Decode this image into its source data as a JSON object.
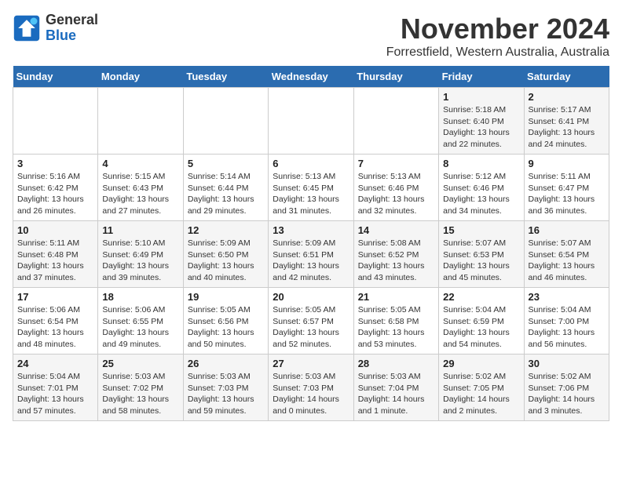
{
  "header": {
    "logo_line1": "General",
    "logo_line2": "Blue",
    "title": "November 2024",
    "subtitle": "Forrestfield, Western Australia, Australia"
  },
  "weekdays": [
    "Sunday",
    "Monday",
    "Tuesday",
    "Wednesday",
    "Thursday",
    "Friday",
    "Saturday"
  ],
  "weeks": [
    [
      {
        "day": "",
        "detail": ""
      },
      {
        "day": "",
        "detail": ""
      },
      {
        "day": "",
        "detail": ""
      },
      {
        "day": "",
        "detail": ""
      },
      {
        "day": "",
        "detail": ""
      },
      {
        "day": "1",
        "detail": "Sunrise: 5:18 AM\nSunset: 6:40 PM\nDaylight: 13 hours\nand 22 minutes."
      },
      {
        "day": "2",
        "detail": "Sunrise: 5:17 AM\nSunset: 6:41 PM\nDaylight: 13 hours\nand 24 minutes."
      }
    ],
    [
      {
        "day": "3",
        "detail": "Sunrise: 5:16 AM\nSunset: 6:42 PM\nDaylight: 13 hours\nand 26 minutes."
      },
      {
        "day": "4",
        "detail": "Sunrise: 5:15 AM\nSunset: 6:43 PM\nDaylight: 13 hours\nand 27 minutes."
      },
      {
        "day": "5",
        "detail": "Sunrise: 5:14 AM\nSunset: 6:44 PM\nDaylight: 13 hours\nand 29 minutes."
      },
      {
        "day": "6",
        "detail": "Sunrise: 5:13 AM\nSunset: 6:45 PM\nDaylight: 13 hours\nand 31 minutes."
      },
      {
        "day": "7",
        "detail": "Sunrise: 5:13 AM\nSunset: 6:46 PM\nDaylight: 13 hours\nand 32 minutes."
      },
      {
        "day": "8",
        "detail": "Sunrise: 5:12 AM\nSunset: 6:46 PM\nDaylight: 13 hours\nand 34 minutes."
      },
      {
        "day": "9",
        "detail": "Sunrise: 5:11 AM\nSunset: 6:47 PM\nDaylight: 13 hours\nand 36 minutes."
      }
    ],
    [
      {
        "day": "10",
        "detail": "Sunrise: 5:11 AM\nSunset: 6:48 PM\nDaylight: 13 hours\nand 37 minutes."
      },
      {
        "day": "11",
        "detail": "Sunrise: 5:10 AM\nSunset: 6:49 PM\nDaylight: 13 hours\nand 39 minutes."
      },
      {
        "day": "12",
        "detail": "Sunrise: 5:09 AM\nSunset: 6:50 PM\nDaylight: 13 hours\nand 40 minutes."
      },
      {
        "day": "13",
        "detail": "Sunrise: 5:09 AM\nSunset: 6:51 PM\nDaylight: 13 hours\nand 42 minutes."
      },
      {
        "day": "14",
        "detail": "Sunrise: 5:08 AM\nSunset: 6:52 PM\nDaylight: 13 hours\nand 43 minutes."
      },
      {
        "day": "15",
        "detail": "Sunrise: 5:07 AM\nSunset: 6:53 PM\nDaylight: 13 hours\nand 45 minutes."
      },
      {
        "day": "16",
        "detail": "Sunrise: 5:07 AM\nSunset: 6:54 PM\nDaylight: 13 hours\nand 46 minutes."
      }
    ],
    [
      {
        "day": "17",
        "detail": "Sunrise: 5:06 AM\nSunset: 6:54 PM\nDaylight: 13 hours\nand 48 minutes."
      },
      {
        "day": "18",
        "detail": "Sunrise: 5:06 AM\nSunset: 6:55 PM\nDaylight: 13 hours\nand 49 minutes."
      },
      {
        "day": "19",
        "detail": "Sunrise: 5:05 AM\nSunset: 6:56 PM\nDaylight: 13 hours\nand 50 minutes."
      },
      {
        "day": "20",
        "detail": "Sunrise: 5:05 AM\nSunset: 6:57 PM\nDaylight: 13 hours\nand 52 minutes."
      },
      {
        "day": "21",
        "detail": "Sunrise: 5:05 AM\nSunset: 6:58 PM\nDaylight: 13 hours\nand 53 minutes."
      },
      {
        "day": "22",
        "detail": "Sunrise: 5:04 AM\nSunset: 6:59 PM\nDaylight: 13 hours\nand 54 minutes."
      },
      {
        "day": "23",
        "detail": "Sunrise: 5:04 AM\nSunset: 7:00 PM\nDaylight: 13 hours\nand 56 minutes."
      }
    ],
    [
      {
        "day": "24",
        "detail": "Sunrise: 5:04 AM\nSunset: 7:01 PM\nDaylight: 13 hours\nand 57 minutes."
      },
      {
        "day": "25",
        "detail": "Sunrise: 5:03 AM\nSunset: 7:02 PM\nDaylight: 13 hours\nand 58 minutes."
      },
      {
        "day": "26",
        "detail": "Sunrise: 5:03 AM\nSunset: 7:03 PM\nDaylight: 13 hours\nand 59 minutes."
      },
      {
        "day": "27",
        "detail": "Sunrise: 5:03 AM\nSunset: 7:03 PM\nDaylight: 14 hours\nand 0 minutes."
      },
      {
        "day": "28",
        "detail": "Sunrise: 5:03 AM\nSunset: 7:04 PM\nDaylight: 14 hours\nand 1 minute."
      },
      {
        "day": "29",
        "detail": "Sunrise: 5:02 AM\nSunset: 7:05 PM\nDaylight: 14 hours\nand 2 minutes."
      },
      {
        "day": "30",
        "detail": "Sunrise: 5:02 AM\nSunset: 7:06 PM\nDaylight: 14 hours\nand 3 minutes."
      }
    ]
  ]
}
